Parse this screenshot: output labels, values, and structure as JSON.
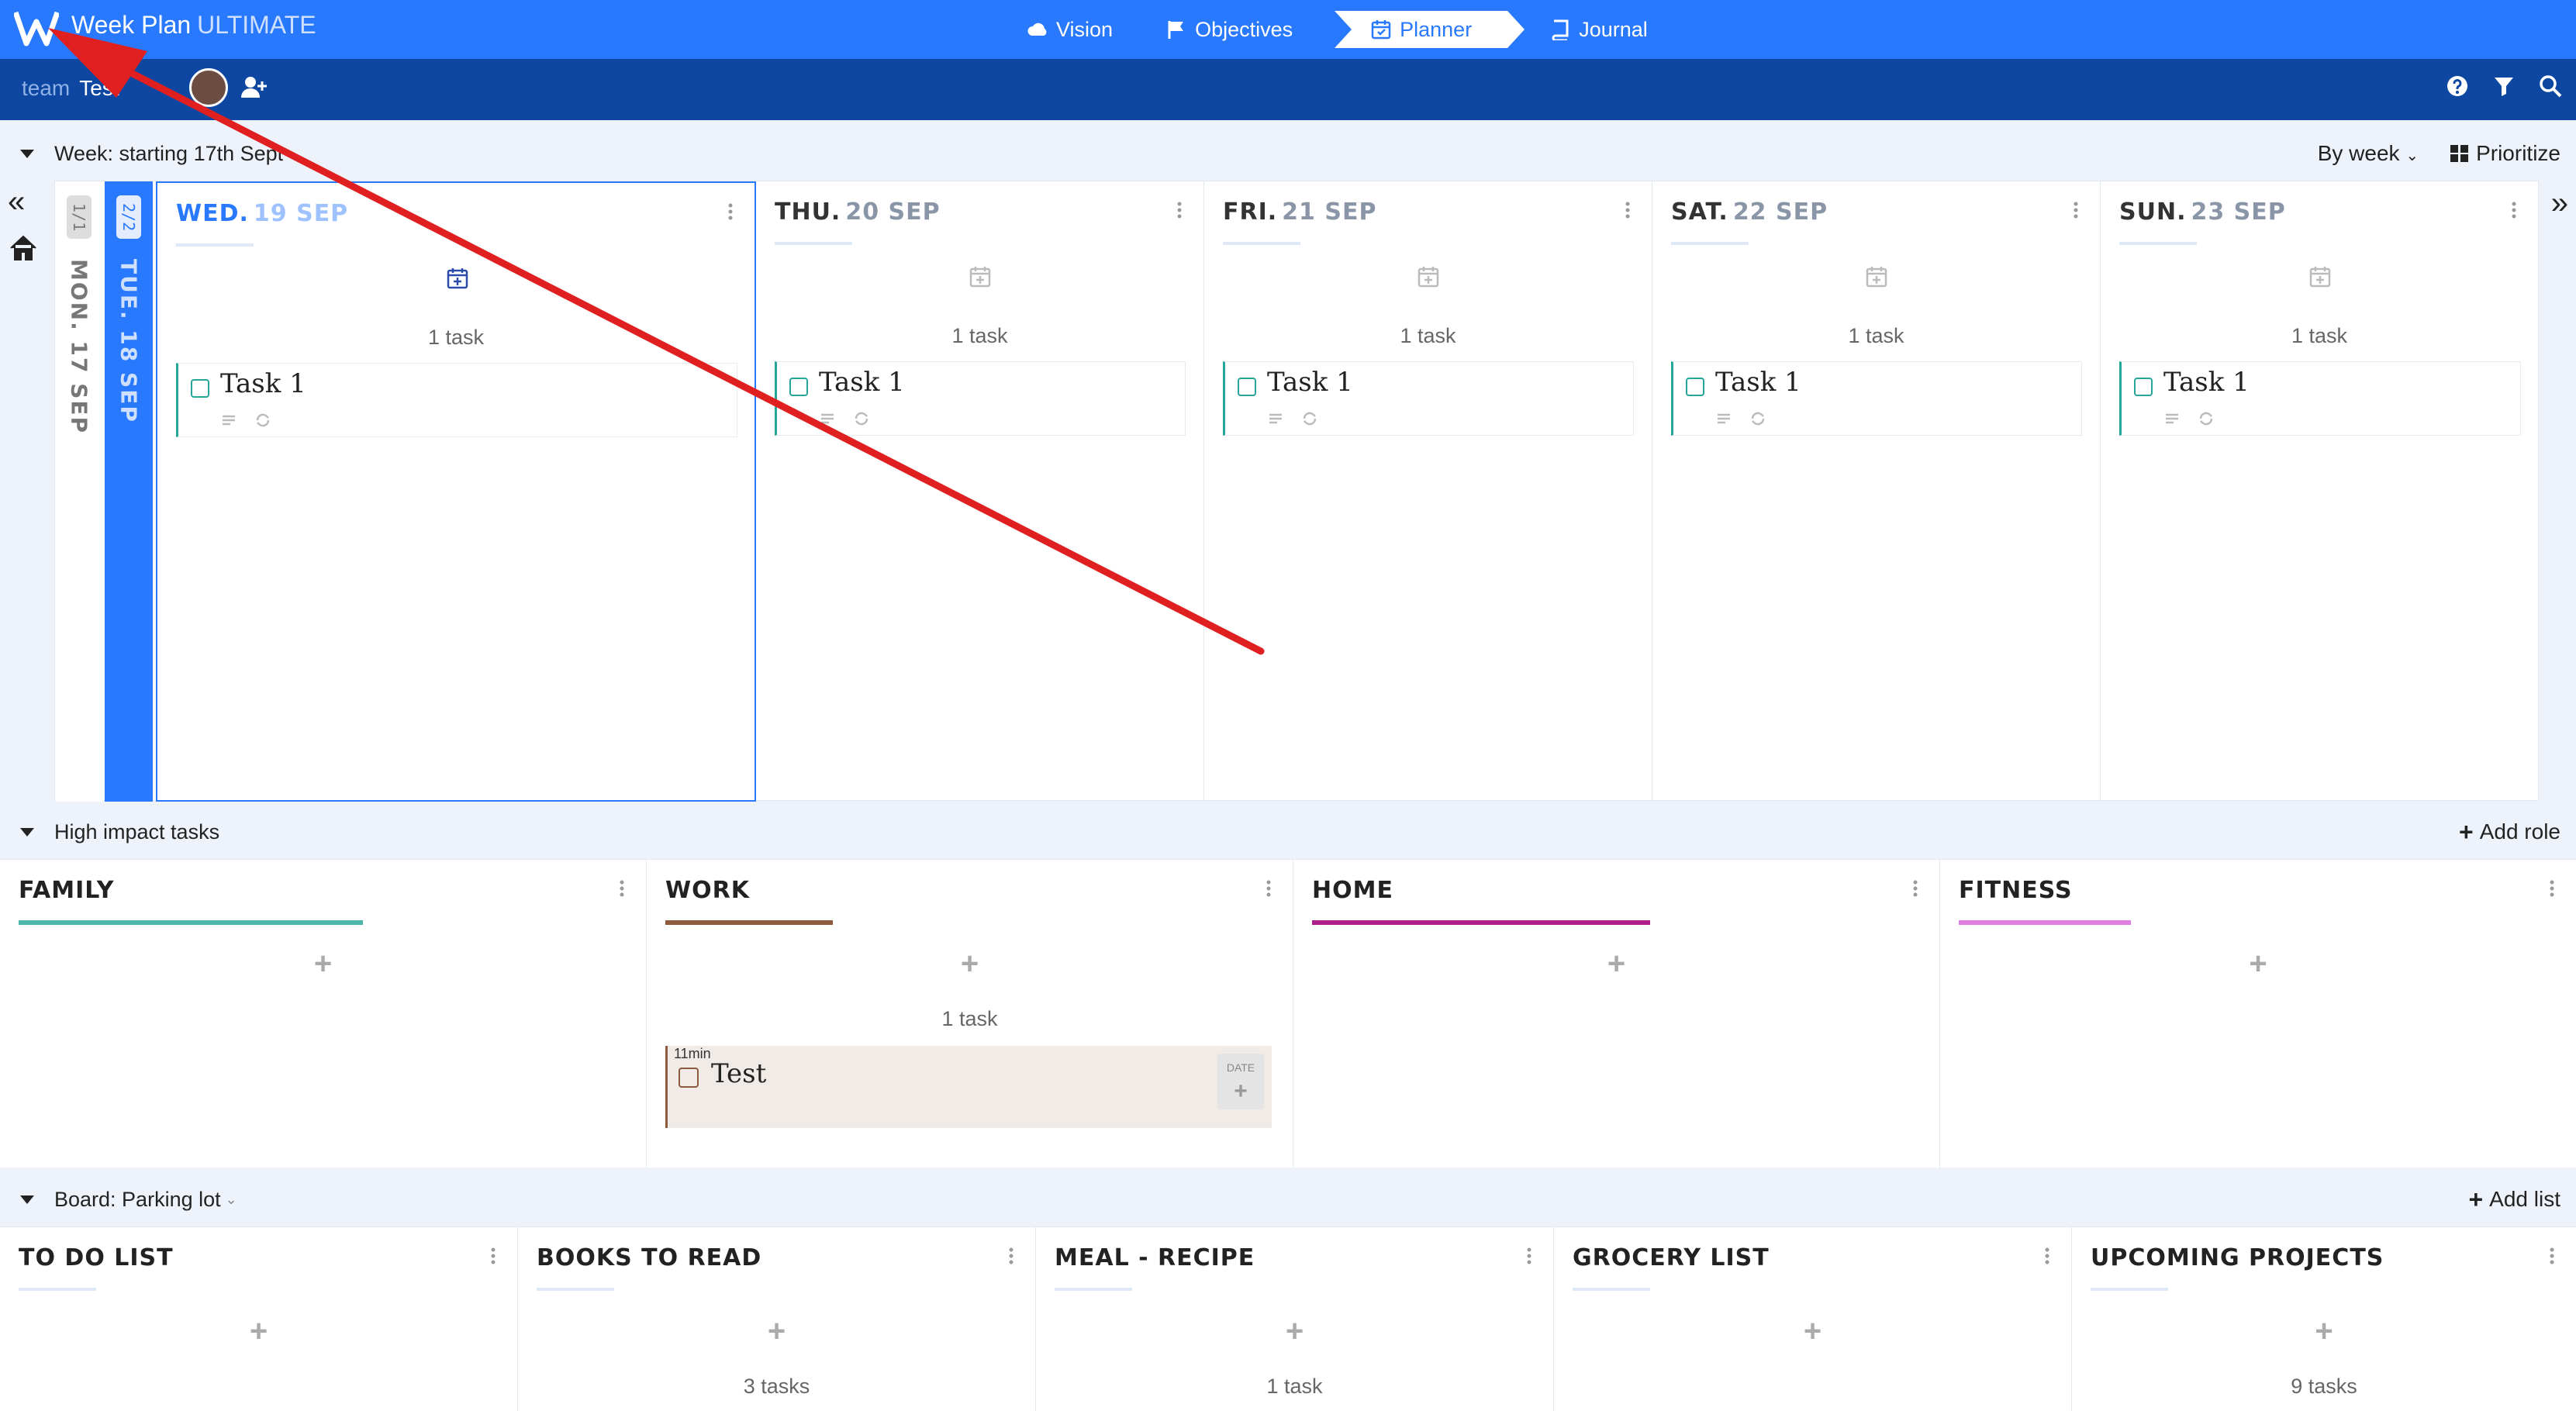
{
  "app": {
    "title": "Week Plan",
    "edition": "ULTIMATE"
  },
  "nav": [
    {
      "label": "Vision",
      "icon": "cloud-icon"
    },
    {
      "label": "Objectives",
      "icon": "flag-icon"
    },
    {
      "label": "Planner",
      "icon": "calendar-icon",
      "active": true
    },
    {
      "label": "Journal",
      "icon": "book-icon"
    }
  ],
  "team": {
    "prefix": "team",
    "name": "Test"
  },
  "week": {
    "label": "Week: starting 17th Sept",
    "view": "By week",
    "prioritize": "Prioritize"
  },
  "mini_days": [
    {
      "frac": "1/1",
      "label": "MON. 17 SEP"
    },
    {
      "frac": "2/2",
      "label": "TUE. 18 SEP"
    }
  ],
  "days": [
    {
      "day": "WED.",
      "date": "19 SEP",
      "count": "1 task",
      "task": "Task 1"
    },
    {
      "day": "THU.",
      "date": "20 SEP",
      "count": "1 task",
      "task": "Task 1"
    },
    {
      "day": "FRI.",
      "date": "21 SEP",
      "count": "1 task",
      "task": "Task 1"
    },
    {
      "day": "SAT.",
      "date": "22 SEP",
      "count": "1 task",
      "task": "Task 1"
    },
    {
      "day": "SUN.",
      "date": "23 SEP",
      "count": "1 task",
      "task": "Task 1"
    }
  ],
  "impact": {
    "label": "High impact tasks",
    "add": "Add role"
  },
  "roles": [
    {
      "name": "FAMILY",
      "color": "#4db6ac",
      "count": ""
    },
    {
      "name": "WORK",
      "color": "#8d5a3b",
      "count": "1 task",
      "task": {
        "duration": "11min",
        "title": "Test",
        "date_label": "DATE"
      }
    },
    {
      "name": "HOME",
      "color": "#ad1f8a",
      "count": ""
    },
    {
      "name": "FITNESS",
      "color": "#e07de0",
      "count": ""
    }
  ],
  "board": {
    "label": "Board: Parking lot",
    "add": "Add list"
  },
  "lists": [
    {
      "name": "TO DO LIST",
      "count": ""
    },
    {
      "name": "BOOKS TO READ",
      "count": "3 tasks"
    },
    {
      "name": "MEAL - RECIPE",
      "count": "1 task"
    },
    {
      "name": "GROCERY LIST",
      "count": ""
    },
    {
      "name": "UPCOMING PROJECTS",
      "count": "9 tasks"
    }
  ]
}
